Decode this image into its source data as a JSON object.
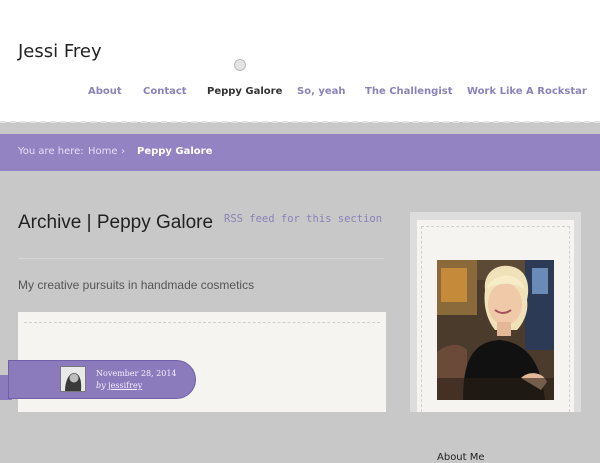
{
  "site": {
    "title": "Jessi Frey"
  },
  "nav": {
    "items": [
      {
        "label": "About",
        "current": false
      },
      {
        "label": "Contact",
        "current": false
      },
      {
        "label": "Peppy Galore",
        "current": true
      },
      {
        "label": "So, yeah",
        "current": false
      },
      {
        "label": "The Challengist",
        "current": false
      },
      {
        "label": "Work Like A Rockstar",
        "current": false
      }
    ]
  },
  "breadcrumb": {
    "prefix": "You are here:",
    "home": "Home",
    "separator": "›",
    "current": "Peppy Galore"
  },
  "archive": {
    "title": "Archive | Peppy Galore",
    "rss_label": "RSS feed for this section",
    "description": "My creative pursuits in handmade cosmetics"
  },
  "post": {
    "date": "November 28, 2014",
    "by_prefix": "by",
    "author": "jessifrey"
  },
  "sidebar": {
    "about_title": "About Me"
  },
  "colors": {
    "accent": "#9483c3",
    "nav_link": "#8b82b8",
    "page_bg": "#c8c8c8"
  },
  "icons": {
    "header_dot": "circle-dot-icon",
    "breadcrumb_separator": "chevron-right-icon"
  }
}
